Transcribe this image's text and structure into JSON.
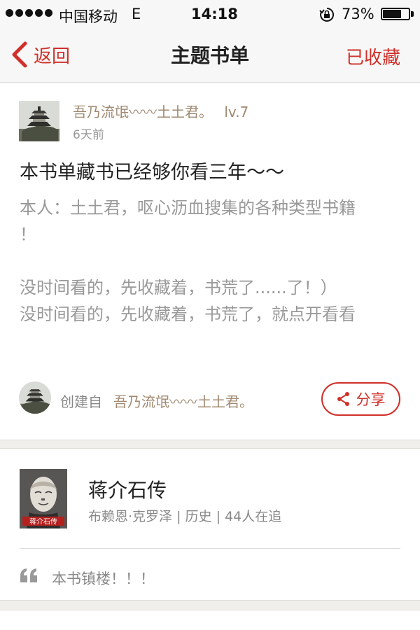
{
  "status_bar": {
    "carrier": "中国移动",
    "network": "E",
    "time": "14:18",
    "battery_percent": "73%",
    "battery_level": 0.73,
    "icons": [
      "signal-dots",
      "rotation-lock-icon",
      "battery-icon"
    ]
  },
  "nav": {
    "back_label": "返回",
    "title": "主题书单",
    "favorite_label": "已收藏",
    "accent_color": "#d0302a"
  },
  "booklist": {
    "author": {
      "name": "吾乃流氓〰〰土土君。",
      "level": "lv.7",
      "time": "6天前"
    },
    "title": "本书单藏书已经够你看三年～～",
    "description": [
      "本人：土土君，呕心沥血搜集的各种类型书籍",
      "！",
      "",
      "没时间看的，先收藏着，书荒了......了！）",
      "没时间看的，先收藏着，书荒了，就点开看看"
    ],
    "creator_label": "创建自",
    "creator_name": "吾乃流氓〰〰土土君。",
    "share_label": "分享"
  },
  "book": {
    "title": "蒋介石传",
    "author": "布赖恩·克罗泽",
    "category": "历史",
    "followers": "44人在追",
    "cover_text": "蒋介石传",
    "comment": "本书镇楼！！！"
  }
}
